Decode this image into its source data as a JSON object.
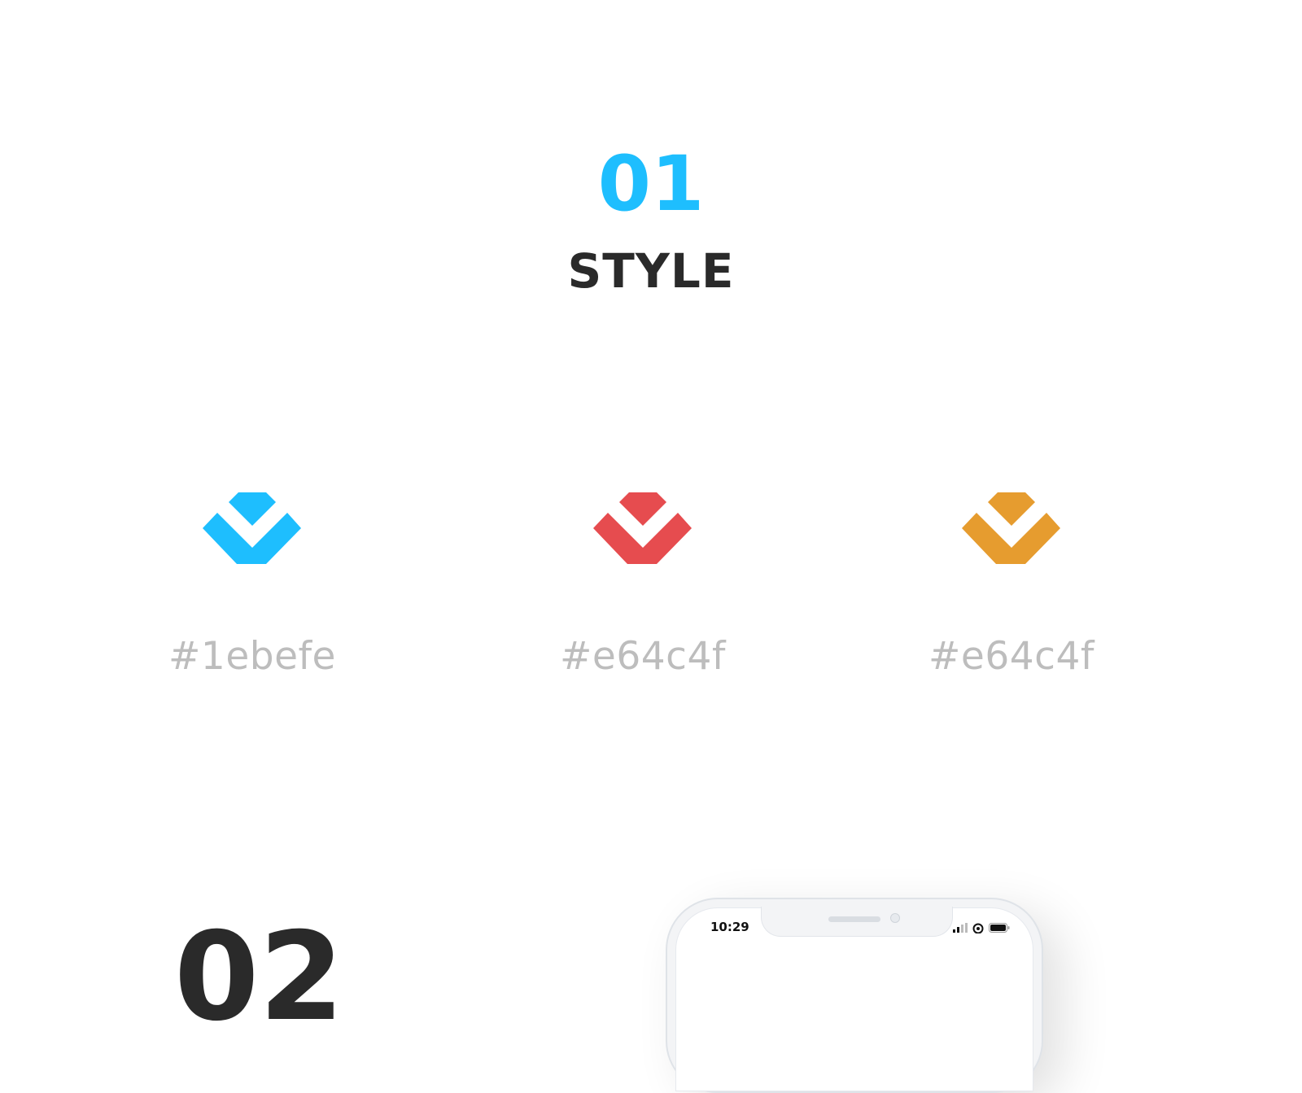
{
  "section": {
    "number": "01",
    "title": "STYLE",
    "number_color": "#1ebefe",
    "title_color": "#2a2a2a"
  },
  "swatches": [
    {
      "icon": "chevron-diamond-icon",
      "color": "#1ebefe",
      "label": "#1ebefe"
    },
    {
      "icon": "chevron-diamond-icon",
      "color": "#e64c4f",
      "label": "#e64c4f"
    },
    {
      "icon": "chevron-diamond-icon",
      "color": "#e69c2f",
      "label": "#e64c4f"
    }
  ],
  "next_section": {
    "number": "02"
  },
  "phone": {
    "status_time": "10:29",
    "status_icons": [
      "signal-icon",
      "wifi-icon",
      "battery-icon"
    ]
  }
}
